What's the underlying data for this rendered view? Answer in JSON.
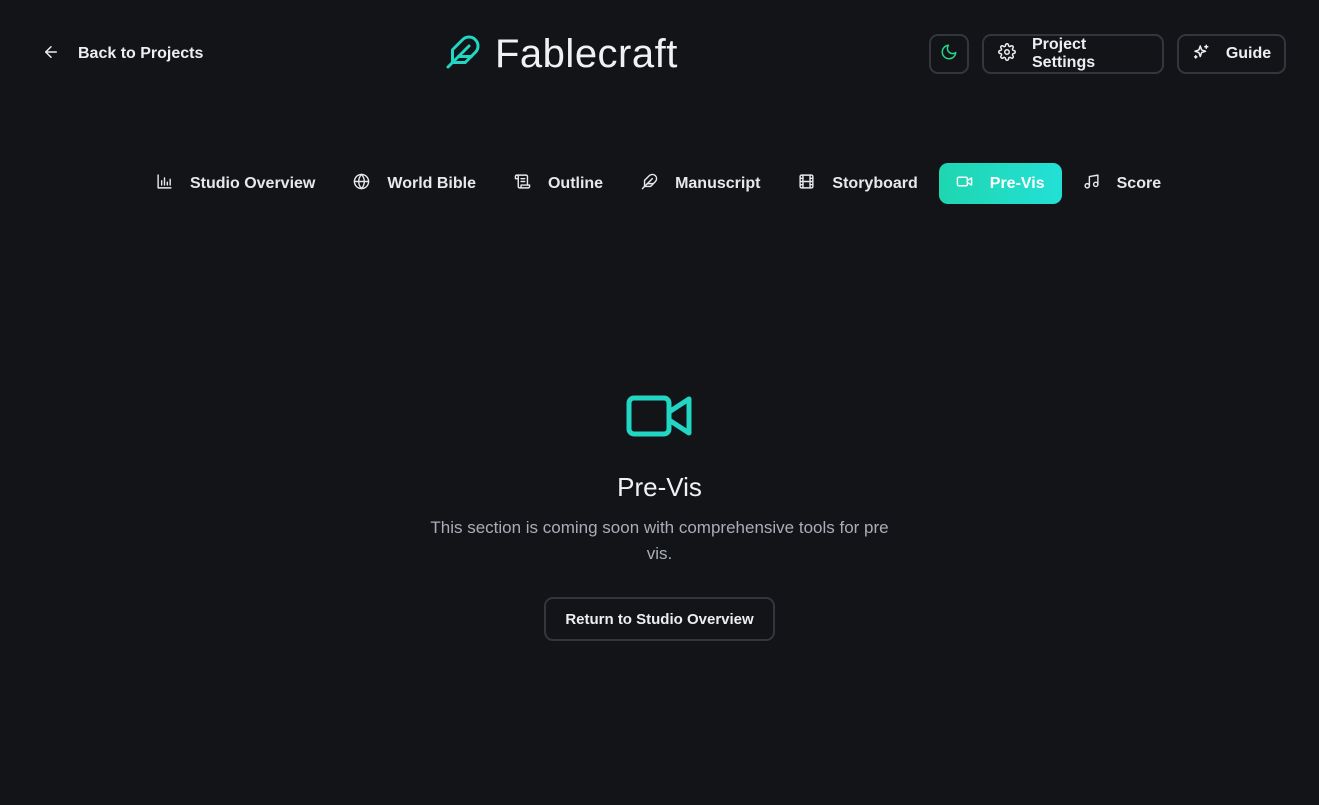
{
  "header": {
    "back_label": "Back to Projects",
    "app_title": "Fablecraft",
    "settings_label": "Project Settings",
    "guide_label": "Guide"
  },
  "colors": {
    "accent": "#22d6c4",
    "active_tab_start": "#1fd6b0",
    "active_tab_end": "#23e0d6",
    "background": "#131418",
    "theme_icon": "#22d68a"
  },
  "tabs": [
    {
      "label": "Studio Overview",
      "icon": "bar-chart-icon",
      "active": false
    },
    {
      "label": "World Bible",
      "icon": "globe-icon",
      "active": false
    },
    {
      "label": "Outline",
      "icon": "scroll-icon",
      "active": false
    },
    {
      "label": "Manuscript",
      "icon": "pen-icon",
      "active": false
    },
    {
      "label": "Storyboard",
      "icon": "film-icon",
      "active": false
    },
    {
      "label": "Pre-Vis",
      "icon": "video-icon",
      "active": true
    },
    {
      "label": "Score",
      "icon": "music-icon",
      "active": false
    }
  ],
  "main": {
    "icon": "video-icon",
    "title": "Pre-Vis",
    "description": "This section is coming soon with comprehensive tools for pre vis.",
    "return_label": "Return to Studio Overview"
  }
}
